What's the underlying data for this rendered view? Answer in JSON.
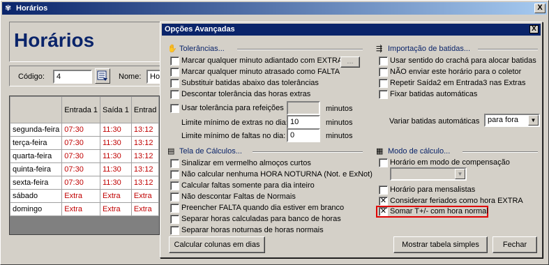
{
  "window": {
    "title": "Horários",
    "close_label": "X"
  },
  "banner": {
    "title": "Horários"
  },
  "codebar": {
    "codigo_label": "Código:",
    "codigo_value": "4",
    "nome_label": "Nome:",
    "nome_value": "Ho"
  },
  "grid": {
    "headers": [
      "Entrada 1",
      "Saída 1",
      "Entrad"
    ],
    "rows": [
      {
        "day": "segunda-feira",
        "cells": [
          "07:30",
          "11:30",
          "13:12"
        ]
      },
      {
        "day": "terça-feira",
        "cells": [
          "07:30",
          "11:30",
          "13:12"
        ]
      },
      {
        "day": "quarta-feira",
        "cells": [
          "07:30",
          "11:30",
          "13:12"
        ]
      },
      {
        "day": "quinta-feira",
        "cells": [
          "07:30",
          "11:30",
          "13:12"
        ]
      },
      {
        "day": "sexta-feira",
        "cells": [
          "07:30",
          "11:30",
          "13:12"
        ]
      },
      {
        "day": "sábado",
        "cells": [
          "Extra",
          "Extra",
          "Extra"
        ]
      },
      {
        "day": "domingo",
        "cells": [
          "Extra",
          "Extra",
          "Extra"
        ]
      }
    ]
  },
  "dialog": {
    "title": "Opções Avançadas",
    "close_label": "X",
    "tolerancias": {
      "title": "Tolerâncias...",
      "items": [
        "Marcar qualquer minuto adiantado com EXTRA",
        "Marcar qualquer minuto atrasado como FALTA",
        "Substituir batidas abaixo das tolerâncias",
        "Descontar tolerância das horas extras",
        "Usar tolerância para refeições"
      ],
      "ellipsis_button": "...",
      "refeicoes_value": "",
      "minutos": "minutos",
      "limite_extras_label": "Limite mínimo de extras no dia:",
      "limite_extras_value": "10",
      "limite_faltas_label": "Limite mínimo de faltas no dia:",
      "limite_faltas_value": "0"
    },
    "importacao": {
      "title": "Importação de batidas...",
      "items": [
        "Usar sentido do crachá para alocar batidas",
        "NÃO enviar este horário para o coletor",
        "Repetir Saída2 em Entrada3 nas Extras",
        "Fixar batidas automáticas"
      ],
      "variar_label": "Variar batidas automáticas",
      "variar_value": "para fora"
    },
    "tela_calculos": {
      "title": "Tela de Cálculos...",
      "items": [
        "Sinalizar em vermelho almoços curtos",
        "Não calcular nenhuma HORA NOTURNA (Not. e ExNot)",
        "Calcular faltas somente para dia inteiro",
        "Não descontar Faltas de Normais",
        "Preencher FALTA quando dia estiver em branco",
        "Separar horas calculadas para banco de horas",
        "Separar horas noturnas de horas normais"
      ]
    },
    "modo_calculo": {
      "title": "Modo de cálculo...",
      "items": [
        {
          "label": "Horário em modo de compensação",
          "checked": false
        },
        {
          "label": "Horário para mensalistas",
          "checked": false
        },
        {
          "label": "Considerar feriados como hora EXTRA",
          "checked": true
        },
        {
          "label": "Somar T+/- com hora normal",
          "checked": true
        }
      ],
      "compensacao_value": ""
    },
    "buttons": {
      "calcular": "Calcular colunas em dias",
      "mostrar": "Mostrar tabela simples",
      "fechar": "Fechar"
    },
    "check_mark": "✕"
  }
}
